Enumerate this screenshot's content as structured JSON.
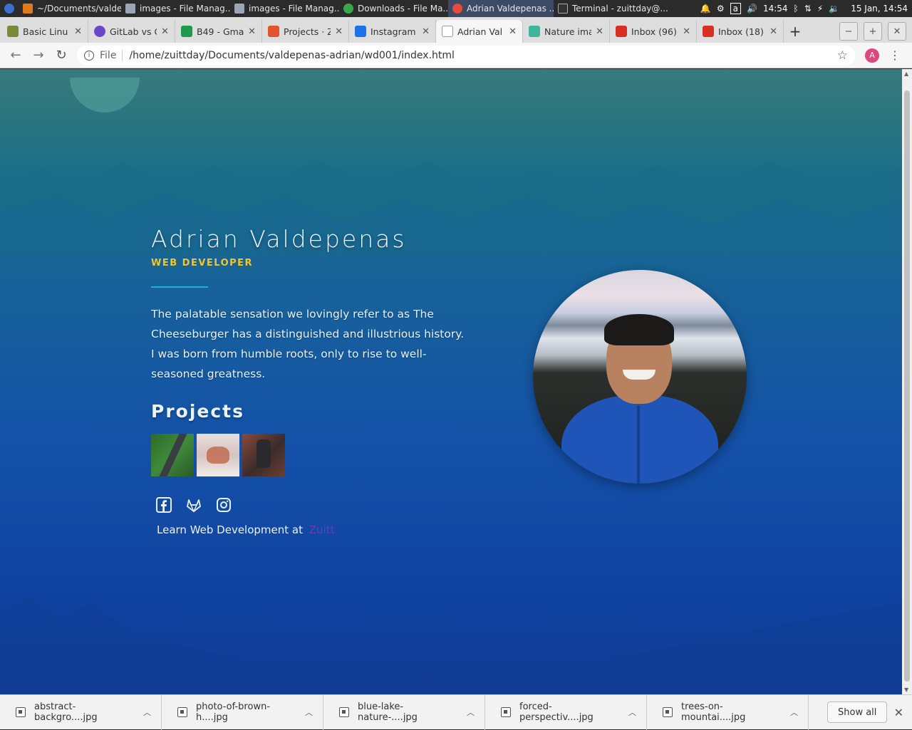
{
  "taskbar": {
    "tasks": [
      {
        "label": "~/Documents/valde...",
        "color": "#e07a1f"
      },
      {
        "label": "images - File Manag...",
        "color": "#9aa6b5"
      },
      {
        "label": "images - File Manag...",
        "color": "#9aa6b5"
      },
      {
        "label": "Downloads - File Ma...",
        "color": "#3aa64a"
      },
      {
        "label": "Adrian Valdepenas ...",
        "color": "#e84a3a"
      },
      {
        "label": "Terminal - zuittday@...",
        "color": "#333333"
      }
    ],
    "time": "14:54",
    "date": "15 Jan, 14:54"
  },
  "tabs": [
    {
      "label": "Basic Linu",
      "color": "#7a8a3a"
    },
    {
      "label": "GitLab vs G",
      "color": "#6b48c8"
    },
    {
      "label": "B49 - Gma",
      "color": "#1e9a4a"
    },
    {
      "label": "Projects · Z",
      "color": "#e2532e"
    },
    {
      "label": "Instagram",
      "color": "#1a73e8"
    },
    {
      "label": "Adrian Val",
      "color": "#dddddd"
    },
    {
      "label": "Nature ima",
      "color": "#3fb5a0"
    },
    {
      "label": "Inbox (96)",
      "color": "#d93025"
    },
    {
      "label": "Inbox (18)",
      "color": "#d93025"
    }
  ],
  "address": {
    "protocol": "File",
    "url": "/home/zuittday/Documents/valdepenas-adrian/wd001/index.html"
  },
  "profile_initial": "A",
  "page": {
    "name": "Adrian Valdepenas",
    "role": "WEB DEVELOPER",
    "bio": "The palatable sensation we lovingly refer to as The Cheeseburger has a distinguished and illustrious history. I was born from humble roots, only to rise to well-seasoned greatness.",
    "projects_heading": "Projects",
    "learn_text": "Learn Web Development at",
    "learn_link": "Zuitt",
    "accent_color": "#f5c623"
  },
  "downloads": [
    {
      "file": "abstract-backgro....jpg"
    },
    {
      "file": "photo-of-brown-h....jpg"
    },
    {
      "file": "blue-lake-nature-....jpg"
    },
    {
      "file": "forced-perspectiv....jpg"
    },
    {
      "file": "trees-on-mountai....jpg"
    }
  ],
  "show_all": "Show all"
}
